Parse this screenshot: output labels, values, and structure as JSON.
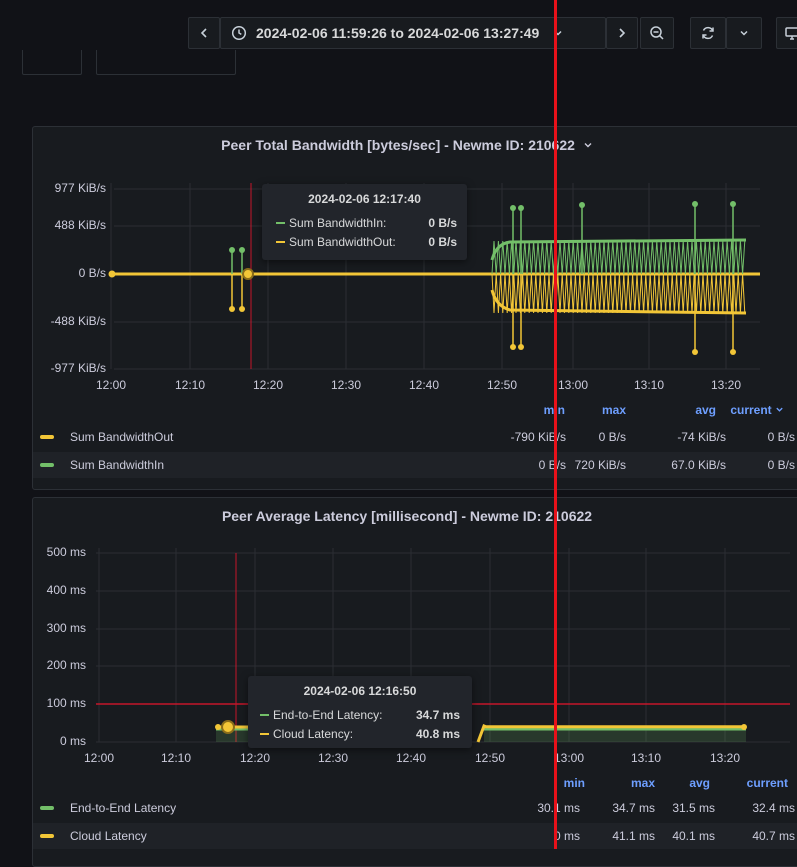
{
  "toolbar": {
    "time_range": "2024-02-06 11:59:26 to 2024-02-06 13:27:49",
    "icons": [
      "chevron-left-icon",
      "clock-icon",
      "chevron-down-icon",
      "chevron-right-icon",
      "zoom-out-icon",
      "refresh-icon",
      "chevron-down-icon",
      "monitor-icon"
    ]
  },
  "colors": {
    "green": "#73bf69",
    "yellow": "#f2c637",
    "red": "#c4162a",
    "blue": "#6e9fff",
    "bg": "#111217",
    "panel": "#181b1f"
  },
  "bandwidth_panel": {
    "title": "Peer Total Bandwidth [bytes/sec] - Newme ID: 210622",
    "yticks": [
      "977 KiB/s",
      "488 KiB/s",
      "0 B/s",
      "-488 KiB/s",
      "-977 KiB/s"
    ],
    "xticks": [
      "12:00",
      "12:10",
      "12:20",
      "12:30",
      "12:40",
      "12:50",
      "13:00",
      "13:10",
      "13:20"
    ],
    "legend_headers": {
      "min": "min",
      "max": "max",
      "avg": "avg",
      "current": "current"
    },
    "legend": [
      {
        "name": "Sum BandwidthOut",
        "color": "#f2c637",
        "min": "-790 KiB/s",
        "max": "0 B/s",
        "avg": "-74 KiB/s",
        "current": "0 B/s"
      },
      {
        "name": "Sum BandwidthIn",
        "color": "#73bf69",
        "min": "0 B/s",
        "max": "720 KiB/s",
        "avg": "67.0 KiB/s",
        "current": "0 B/s"
      }
    ],
    "tooltip": {
      "time": "2024-02-06 12:17:40",
      "rows": [
        {
          "label": "Sum BandwidthIn:",
          "value": "0 B/s",
          "color": "#73bf69"
        },
        {
          "label": "Sum BandwidthOut:",
          "value": "0 B/s",
          "color": "#f2c637"
        }
      ]
    }
  },
  "latency_panel": {
    "title": "Peer Average Latency [millisecond] - Newme ID: 210622",
    "yticks": [
      "500 ms",
      "400 ms",
      "300 ms",
      "200 ms",
      "100 ms",
      "0 ms"
    ],
    "xticks": [
      "12:00",
      "12:10",
      "12:20",
      "12:30",
      "12:40",
      "12:50",
      "13:00",
      "13:10",
      "13:20"
    ],
    "legend_headers": {
      "min": "min",
      "max": "max",
      "avg": "avg",
      "current": "current"
    },
    "legend": [
      {
        "name": "End-to-End Latency",
        "color": "#73bf69",
        "min": "30.1 ms",
        "max": "34.7 ms",
        "avg": "31.5 ms",
        "current": "32.4 ms"
      },
      {
        "name": "Cloud Latency",
        "color": "#f2c637",
        "min": "0 ms",
        "max": "41.1 ms",
        "avg": "40.1 ms",
        "current": "40.7 ms"
      }
    ],
    "tooltip": {
      "time": "2024-02-06 12:16:50",
      "rows": [
        {
          "label": "End-to-End Latency:",
          "value": "34.7 ms",
          "color": "#73bf69"
        },
        {
          "label": "Cloud Latency:",
          "value": "40.8 ms",
          "color": "#f2c637"
        }
      ]
    }
  }
}
